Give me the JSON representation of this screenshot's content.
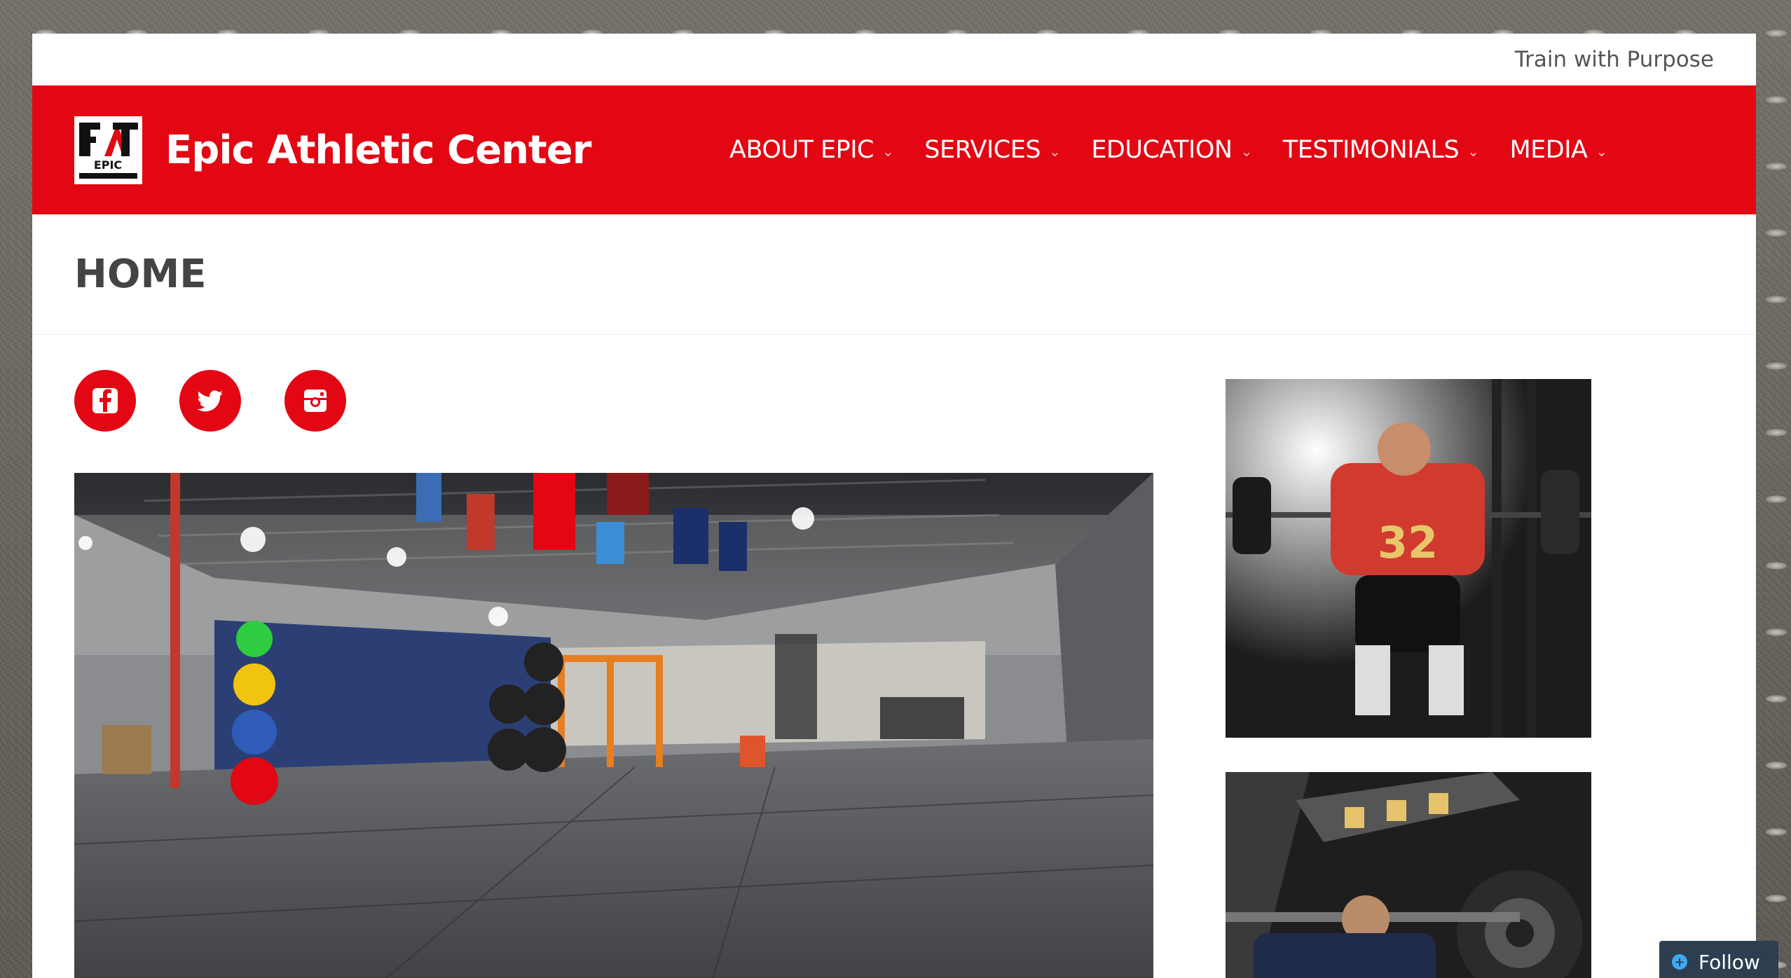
{
  "topbar": {
    "tagline": "Train with Purpose"
  },
  "header": {
    "site_title": "Epic Athletic Center",
    "logo_text": "EPIC",
    "nav": [
      {
        "label": "ABOUT EPIC"
      },
      {
        "label": "SERVICES"
      },
      {
        "label": "EDUCATION"
      },
      {
        "label": "TESTIMONIALS"
      },
      {
        "label": "MEDIA"
      }
    ]
  },
  "main": {
    "page_title": "HOME"
  },
  "social": {
    "icons": [
      "facebook-icon",
      "twitter-icon",
      "instagram-icon"
    ]
  },
  "sidebar": {
    "jersey_number": "32"
  },
  "follow": {
    "label": "Follow"
  },
  "colors": {
    "brand_red": "#e30613",
    "follow_bg": "#2c3e50"
  }
}
